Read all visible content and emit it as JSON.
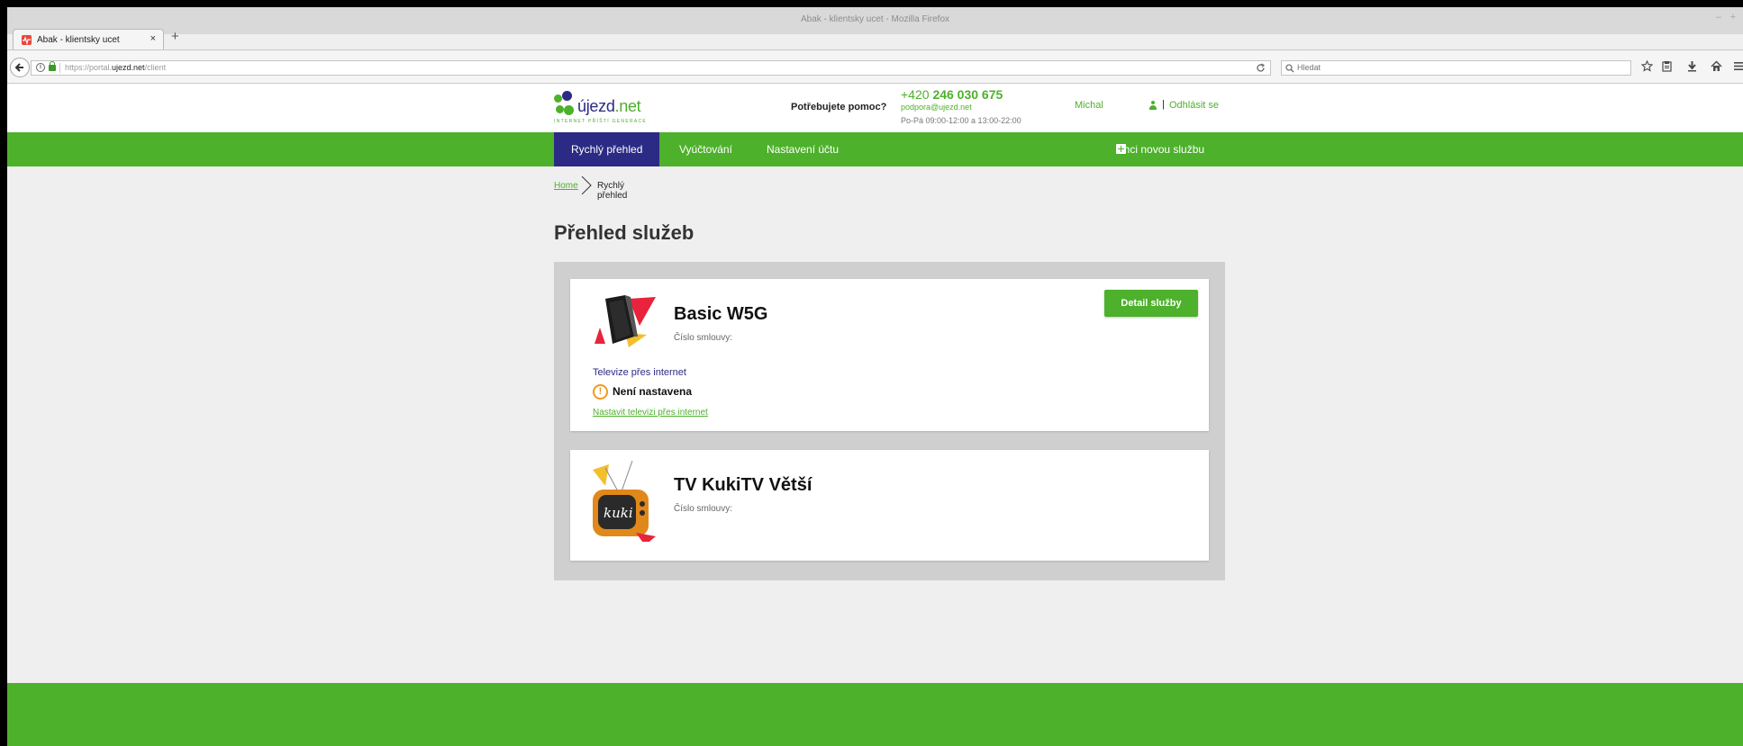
{
  "browser": {
    "window_title": "Abak - klientsky ucet - Mozilla Firefox",
    "window_controls": [
      "–",
      "+"
    ],
    "tab": {
      "title": "Abak - klientsky ucet",
      "close": "×"
    },
    "new_tab": "+",
    "url": {
      "prefix": "https://portal.",
      "host": "ujezd.net",
      "path": "/client"
    },
    "search_placeholder": "Hledat"
  },
  "header": {
    "logo": {
      "name_main": "újezd",
      "name_tld": ".net",
      "tagline": "INTERNET PŘÍŠTÍ GENERACE"
    },
    "help_label": "Potřebujete pomoc?",
    "phone_prefix": "+420 ",
    "phone_number": "246 030 675",
    "email": "podpora@ujezd.net",
    "hours": "Po-Pá 09:00-12:00 a 13:00-22:00",
    "user_name": "Michal",
    "separator": "|",
    "logout": "Odhlásit se"
  },
  "menu": {
    "items": [
      "Rychlý přehled",
      "Vyúčtování",
      "Nastavení účtu"
    ],
    "new_service": "Chci novou službu"
  },
  "breadcrumb": {
    "home": "Home",
    "current": "Rychlý přehled"
  },
  "page_title": "Přehled služeb",
  "services": [
    {
      "name": "Basic W5G",
      "contract_label": "Číslo smlouvy:",
      "detail_button": "Detail služby",
      "tv_label": "Televize přes internet",
      "status": "Není nastavena",
      "setup_link": "Nastavit televizi přes internet"
    },
    {
      "name": "TV KukiTV Větší",
      "contract_label": "Číslo smlouvy:",
      "tv_brand": "kuki"
    }
  ],
  "colors": {
    "brand_green": "#4db12b",
    "brand_navy": "#2b2a84",
    "warning": "#f29a1a"
  }
}
